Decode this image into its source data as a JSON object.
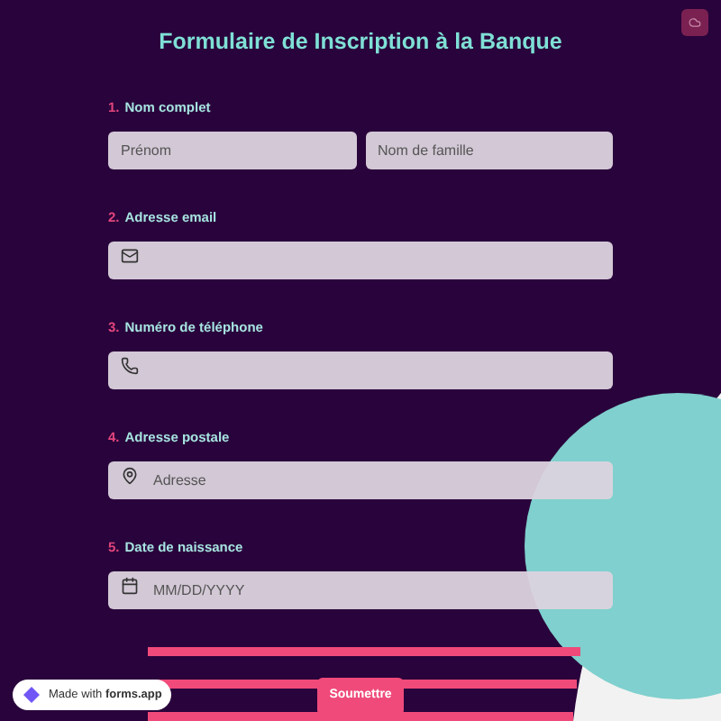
{
  "title": "Formulaire de Inscription à la Banque",
  "questions": [
    {
      "number": "1.",
      "label": "Nom complet",
      "fields": [
        {
          "placeholder": "Prénom",
          "kind": "text"
        },
        {
          "placeholder": "Nom de famille",
          "kind": "text"
        }
      ]
    },
    {
      "number": "2.",
      "label": "Adresse email",
      "fields": [
        {
          "kind": "email"
        }
      ]
    },
    {
      "number": "3.",
      "label": "Numéro de téléphone",
      "fields": [
        {
          "kind": "phone"
        }
      ]
    },
    {
      "number": "4.",
      "label": "Adresse postale",
      "fields": [
        {
          "placeholder": "Adresse",
          "kind": "address"
        }
      ]
    },
    {
      "number": "5.",
      "label": "Date de naissance",
      "fields": [
        {
          "placeholder": "MM/DD/YYYY",
          "kind": "date"
        }
      ]
    }
  ],
  "submit": "Soumettre",
  "badge": "Made with **forms.app**"
}
